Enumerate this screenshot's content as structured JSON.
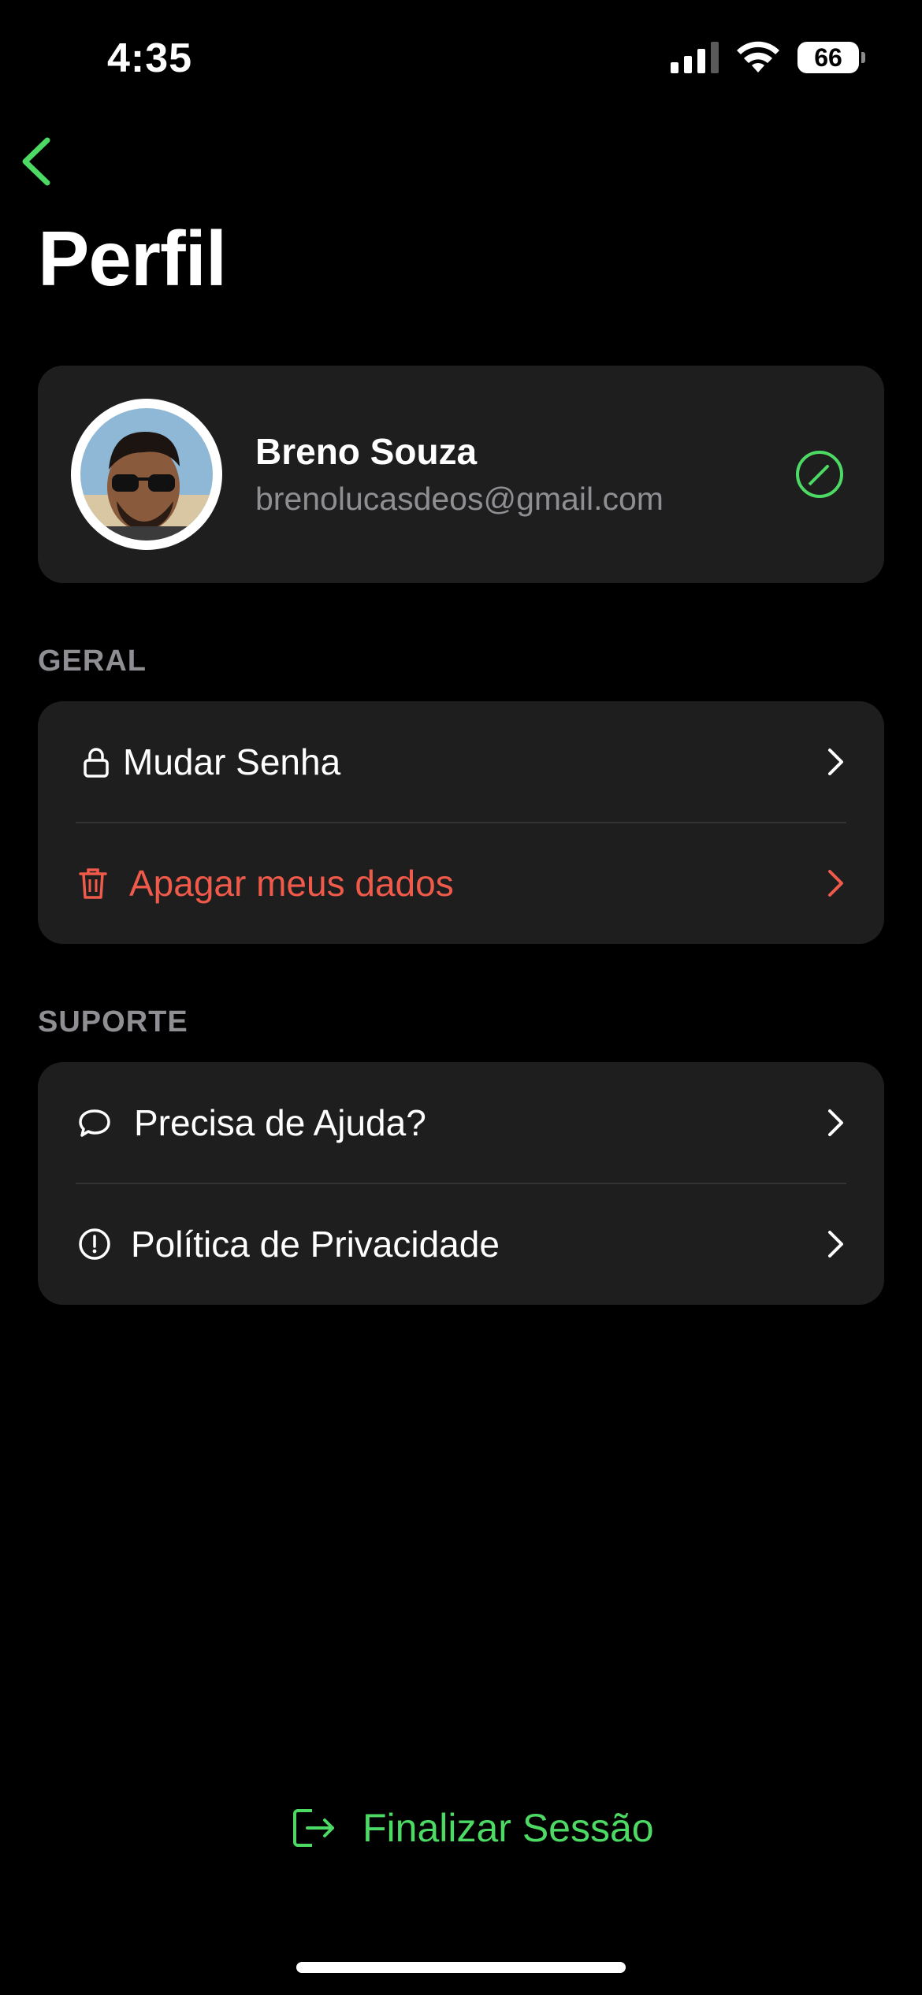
{
  "status": {
    "time": "4:35",
    "battery": "66"
  },
  "header": {
    "title": "Perfil"
  },
  "profile": {
    "name": "Breno Souza",
    "email": "brenolucasdeos@gmail.com"
  },
  "sections": {
    "general": {
      "label": "GERAL",
      "items": [
        {
          "label": "Mudar Senha",
          "icon": "lock-icon"
        },
        {
          "label": "Apagar meus dados",
          "icon": "trash-icon"
        }
      ]
    },
    "support": {
      "label": "SUPORTE",
      "items": [
        {
          "label": "Precisa de Ajuda?",
          "icon": "chat-bubble-icon"
        },
        {
          "label": "Política de Privacidade",
          "icon": "info-circle-icon"
        }
      ]
    }
  },
  "logout": {
    "label": "Finalizar Sessão"
  },
  "colors": {
    "accent": "#4cd964",
    "danger": "#ef5a4a",
    "card": "#1e1e1e",
    "muted": "#8e8e93"
  }
}
